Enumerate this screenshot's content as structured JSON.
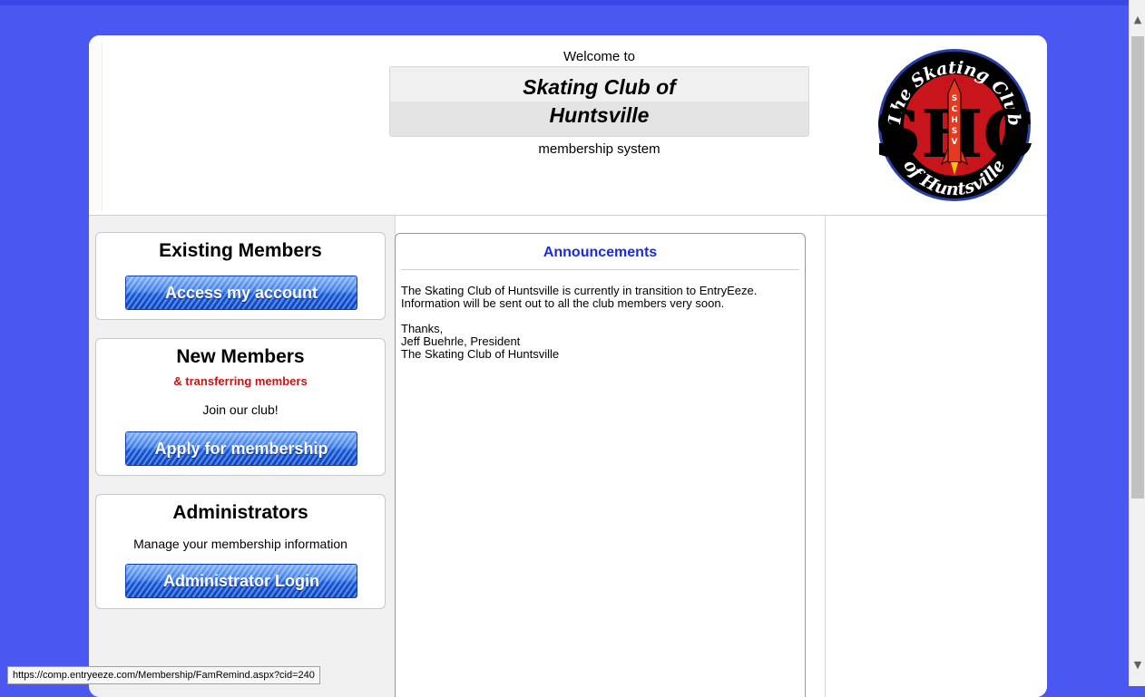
{
  "header": {
    "welcome": "Welcome to",
    "club_name": "Skating Club of\nHuntsville",
    "subtitle": "membership system",
    "logo": {
      "top_text": "The Skating Club",
      "bottom_text": "of Huntsville",
      "initials": "SHC",
      "vertical_text": "SCHSV",
      "colors": {
        "ring": "#000000",
        "center": "#c8151b",
        "border": "#2a3fa8",
        "text": "#ffffff"
      }
    }
  },
  "existing": {
    "title": "Existing Members",
    "button": "Access my account"
  },
  "new": {
    "title": "New Members",
    "subtitle": "& transferring members",
    "text": "Join our club!",
    "button": "Apply for membership"
  },
  "admin": {
    "title": "Administrators",
    "text": "Manage your membership information",
    "button": "Administrator Login"
  },
  "announcements": {
    "title": "Announcements",
    "paragraph1": "The Skating Club of Huntsville is currently in transition to EntryEeze.  Information will be sent out to all the club members very soon.",
    "thanks": "Thanks,",
    "signer": "Jeff Buehrle, President",
    "org": "The Skating Club of Huntsville"
  },
  "status_url": "https://comp.entryeeze.com/Membership/FamRemind.aspx?cid=240",
  "colors": {
    "background": "#4a57f0",
    "link_blue": "#1a2be0",
    "accent_red": "#cc1111",
    "button_blue": "#1659d8"
  }
}
